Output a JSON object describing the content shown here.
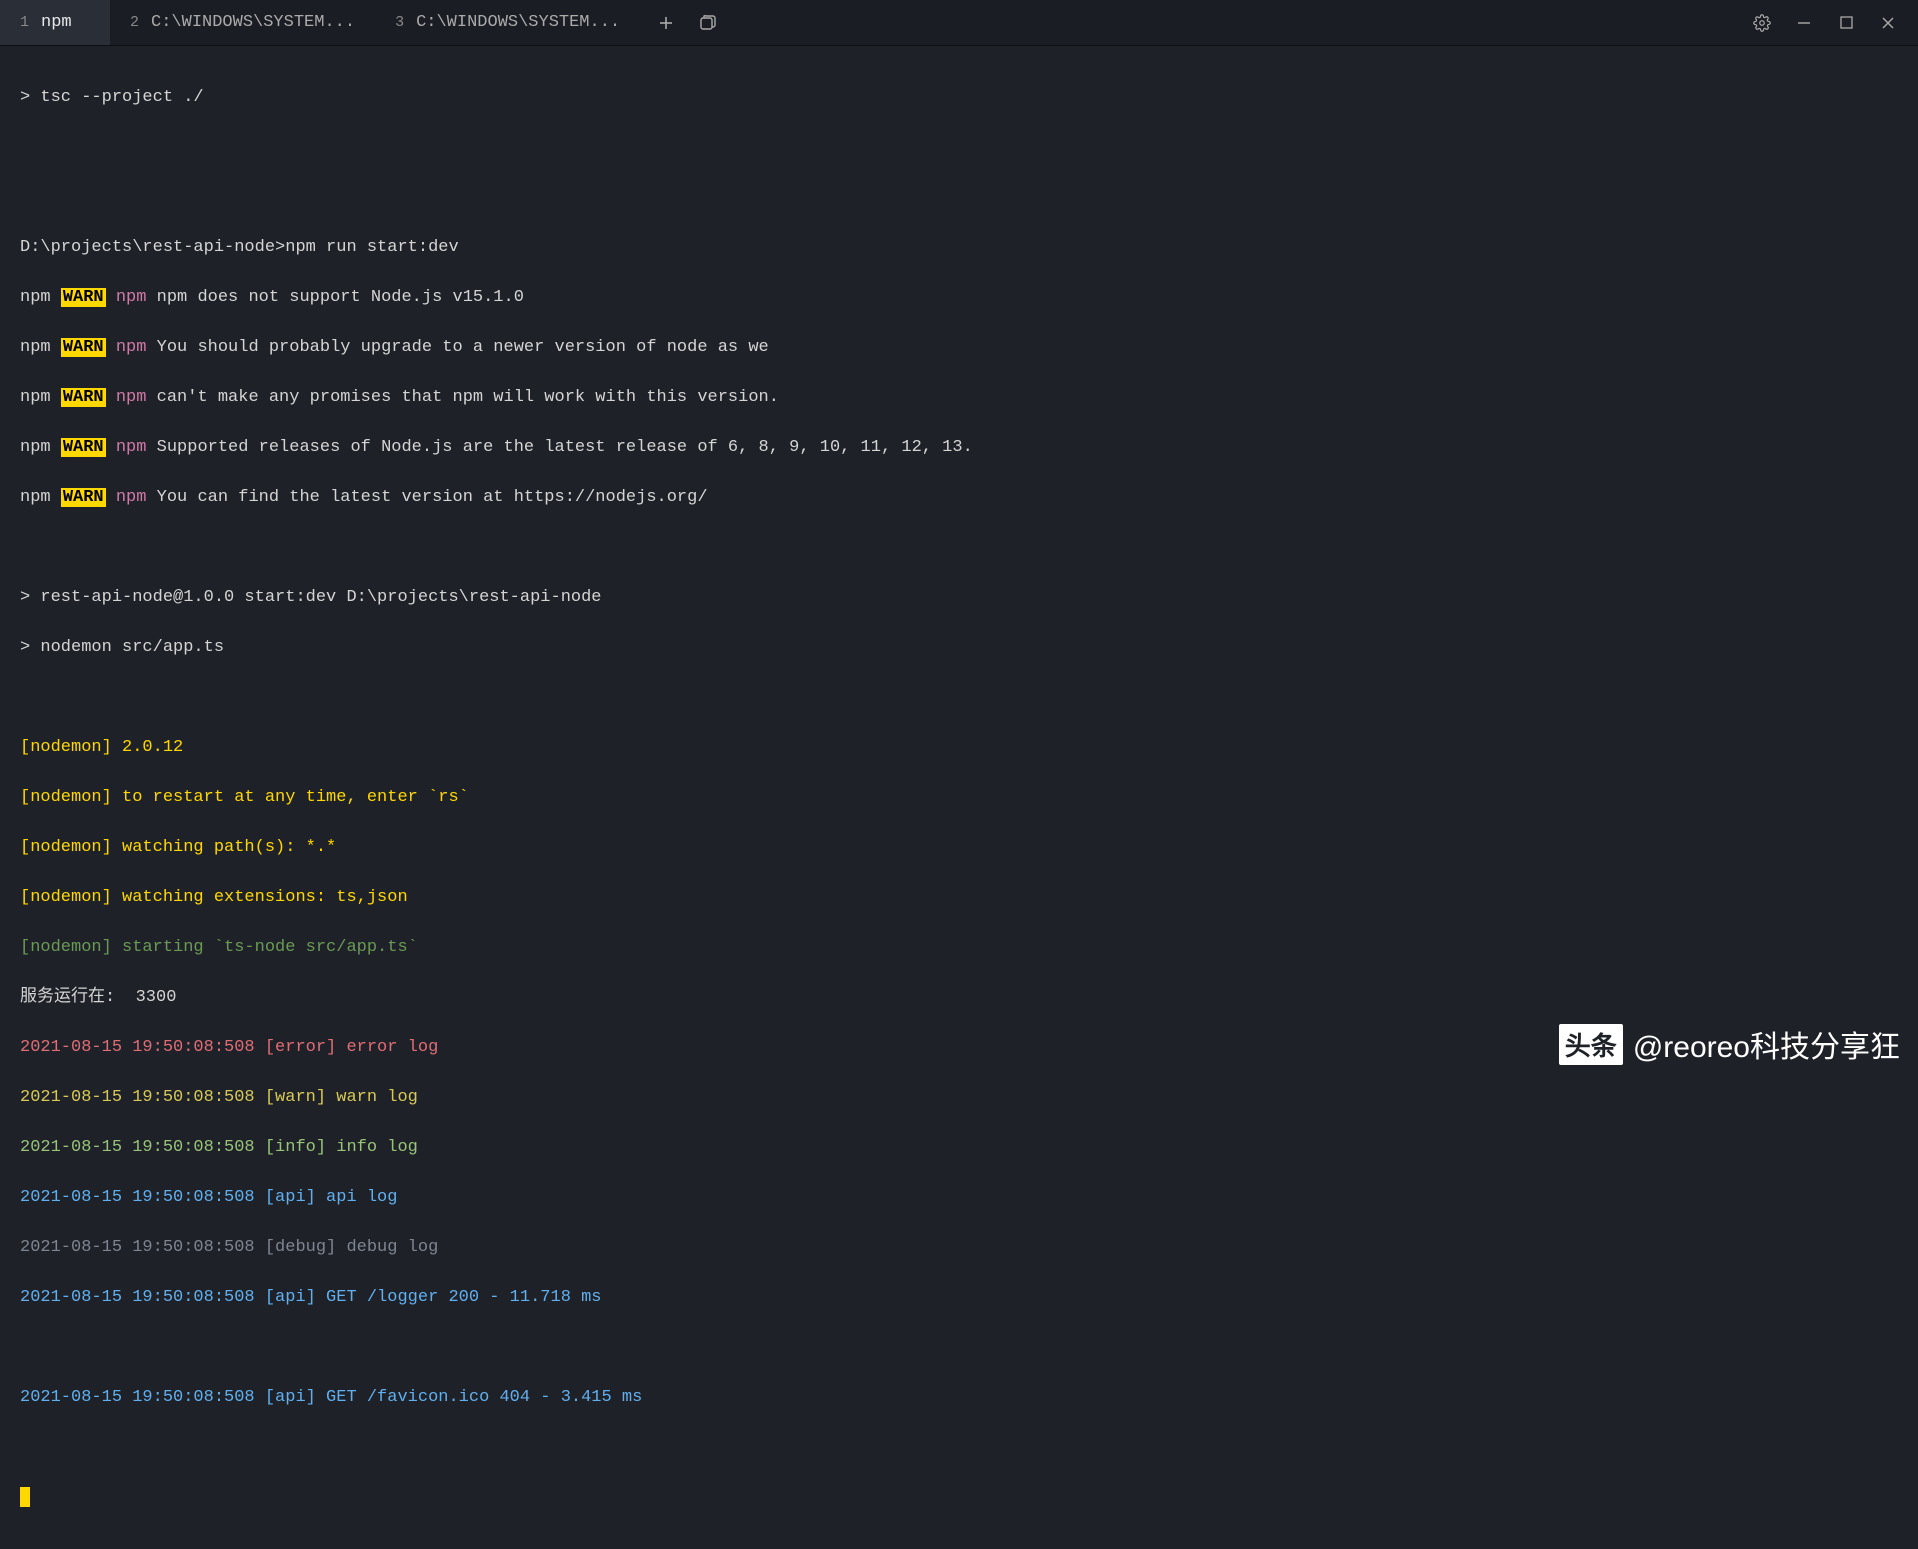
{
  "tabs": [
    {
      "index": "1",
      "label": "npm",
      "active": true
    },
    {
      "index": "2",
      "label": "C:\\WINDOWS\\SYSTEM...",
      "active": false
    },
    {
      "index": "3",
      "label": "C:\\WINDOWS\\SYSTEM...",
      "active": false
    }
  ],
  "prompt_line": "> tsc --project ./",
  "cwd_cmd": "D:\\projects\\rest-api-node>npm run start:dev",
  "warn_lines": [
    "npm does not support Node.js v15.1.0",
    "You should probably upgrade to a newer version of node as we",
    "can't make any promises that npm will work with this version.",
    "Supported releases of Node.js are the latest release of 6, 8, 9, 10, 11, 12, 13.",
    "You can find the latest version at https://nodejs.org/"
  ],
  "script_lines": [
    "> rest-api-node@1.0.0 start:dev D:\\projects\\rest-api-node",
    "> nodemon src/app.ts"
  ],
  "nodemon_yellow": [
    "[nodemon] 2.0.12",
    "[nodemon] to restart at any time, enter `rs`",
    "[nodemon] watching path(s): *.*",
    "[nodemon] watching extensions: ts,json"
  ],
  "nodemon_green": "[nodemon] starting `ts-node src/app.ts`",
  "server_line": "服务运行在:  3300",
  "logs": [
    {
      "cls": "log-red",
      "text": "2021-08-15 19:50:08:508 [error] error log"
    },
    {
      "cls": "log-yellow",
      "text": "2021-08-15 19:50:08:508 [warn] warn log"
    },
    {
      "cls": "log-green",
      "text": "2021-08-15 19:50:08:508 [info] info log"
    },
    {
      "cls": "log-blue",
      "text": "2021-08-15 19:50:08:508 [api] api log"
    },
    {
      "cls": "log-gray",
      "text": "2021-08-15 19:50:08:508 [debug] debug log"
    },
    {
      "cls": "log-blue",
      "text": "2021-08-15 19:50:08:508 [api] GET /logger 200 - 11.718 ms"
    },
    {
      "cls": "",
      "text": ""
    },
    {
      "cls": "log-blue",
      "text": "2021-08-15 19:50:08:508 [api] GET /favicon.ico 404 - 3.415 ms"
    }
  ],
  "watermark": {
    "logo": "头条",
    "text": "@reoreo科技分享狂"
  }
}
